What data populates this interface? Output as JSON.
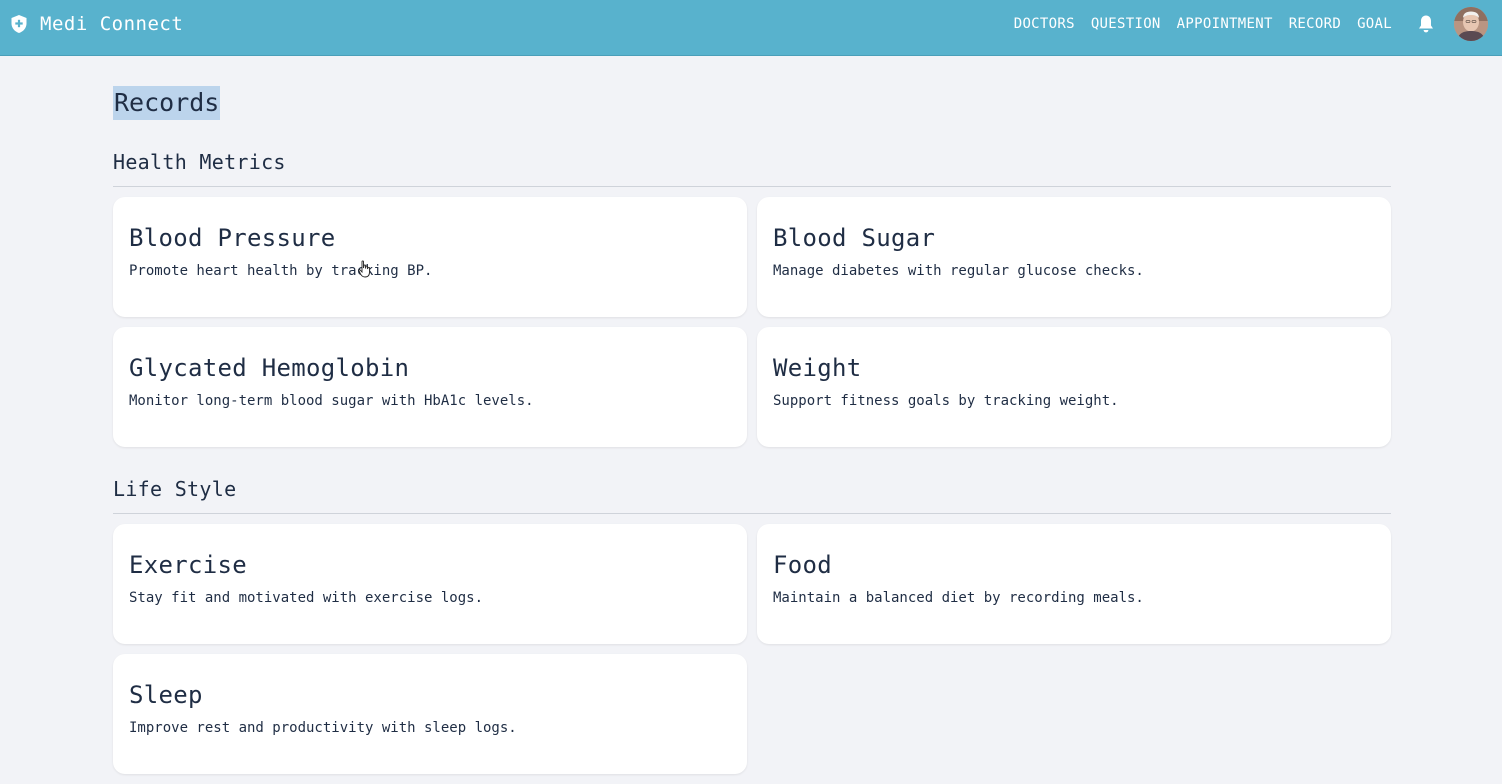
{
  "app": {
    "title": "Medi Connect",
    "brand_color": "#58b2cd"
  },
  "nav": {
    "items": [
      {
        "label": "DOCTORS"
      },
      {
        "label": "QUESTION"
      },
      {
        "label": "APPOINTMENT"
      },
      {
        "label": "RECORD"
      },
      {
        "label": "GOAL"
      }
    ],
    "bell_icon": "bell-icon",
    "avatar_icon": "user-avatar"
  },
  "page": {
    "title": "Records"
  },
  "sections": [
    {
      "title": "Health Metrics",
      "cards": [
        {
          "title": "Blood Pressure",
          "desc": "Promote heart health by tracking BP."
        },
        {
          "title": "Blood Sugar",
          "desc": "Manage diabetes with regular glucose checks."
        },
        {
          "title": "Glycated Hemoglobin",
          "desc": "Monitor long-term blood sugar with HbA1c levels."
        },
        {
          "title": "Weight",
          "desc": "Support fitness goals by tracking weight."
        }
      ]
    },
    {
      "title": "Life Style",
      "cards": [
        {
          "title": "Exercise",
          "desc": "Stay fit and motivated with exercise logs."
        },
        {
          "title": "Food",
          "desc": "Maintain a balanced diet by recording meals."
        },
        {
          "title": "Sleep",
          "desc": "Improve rest and productivity with sleep logs."
        }
      ]
    }
  ]
}
